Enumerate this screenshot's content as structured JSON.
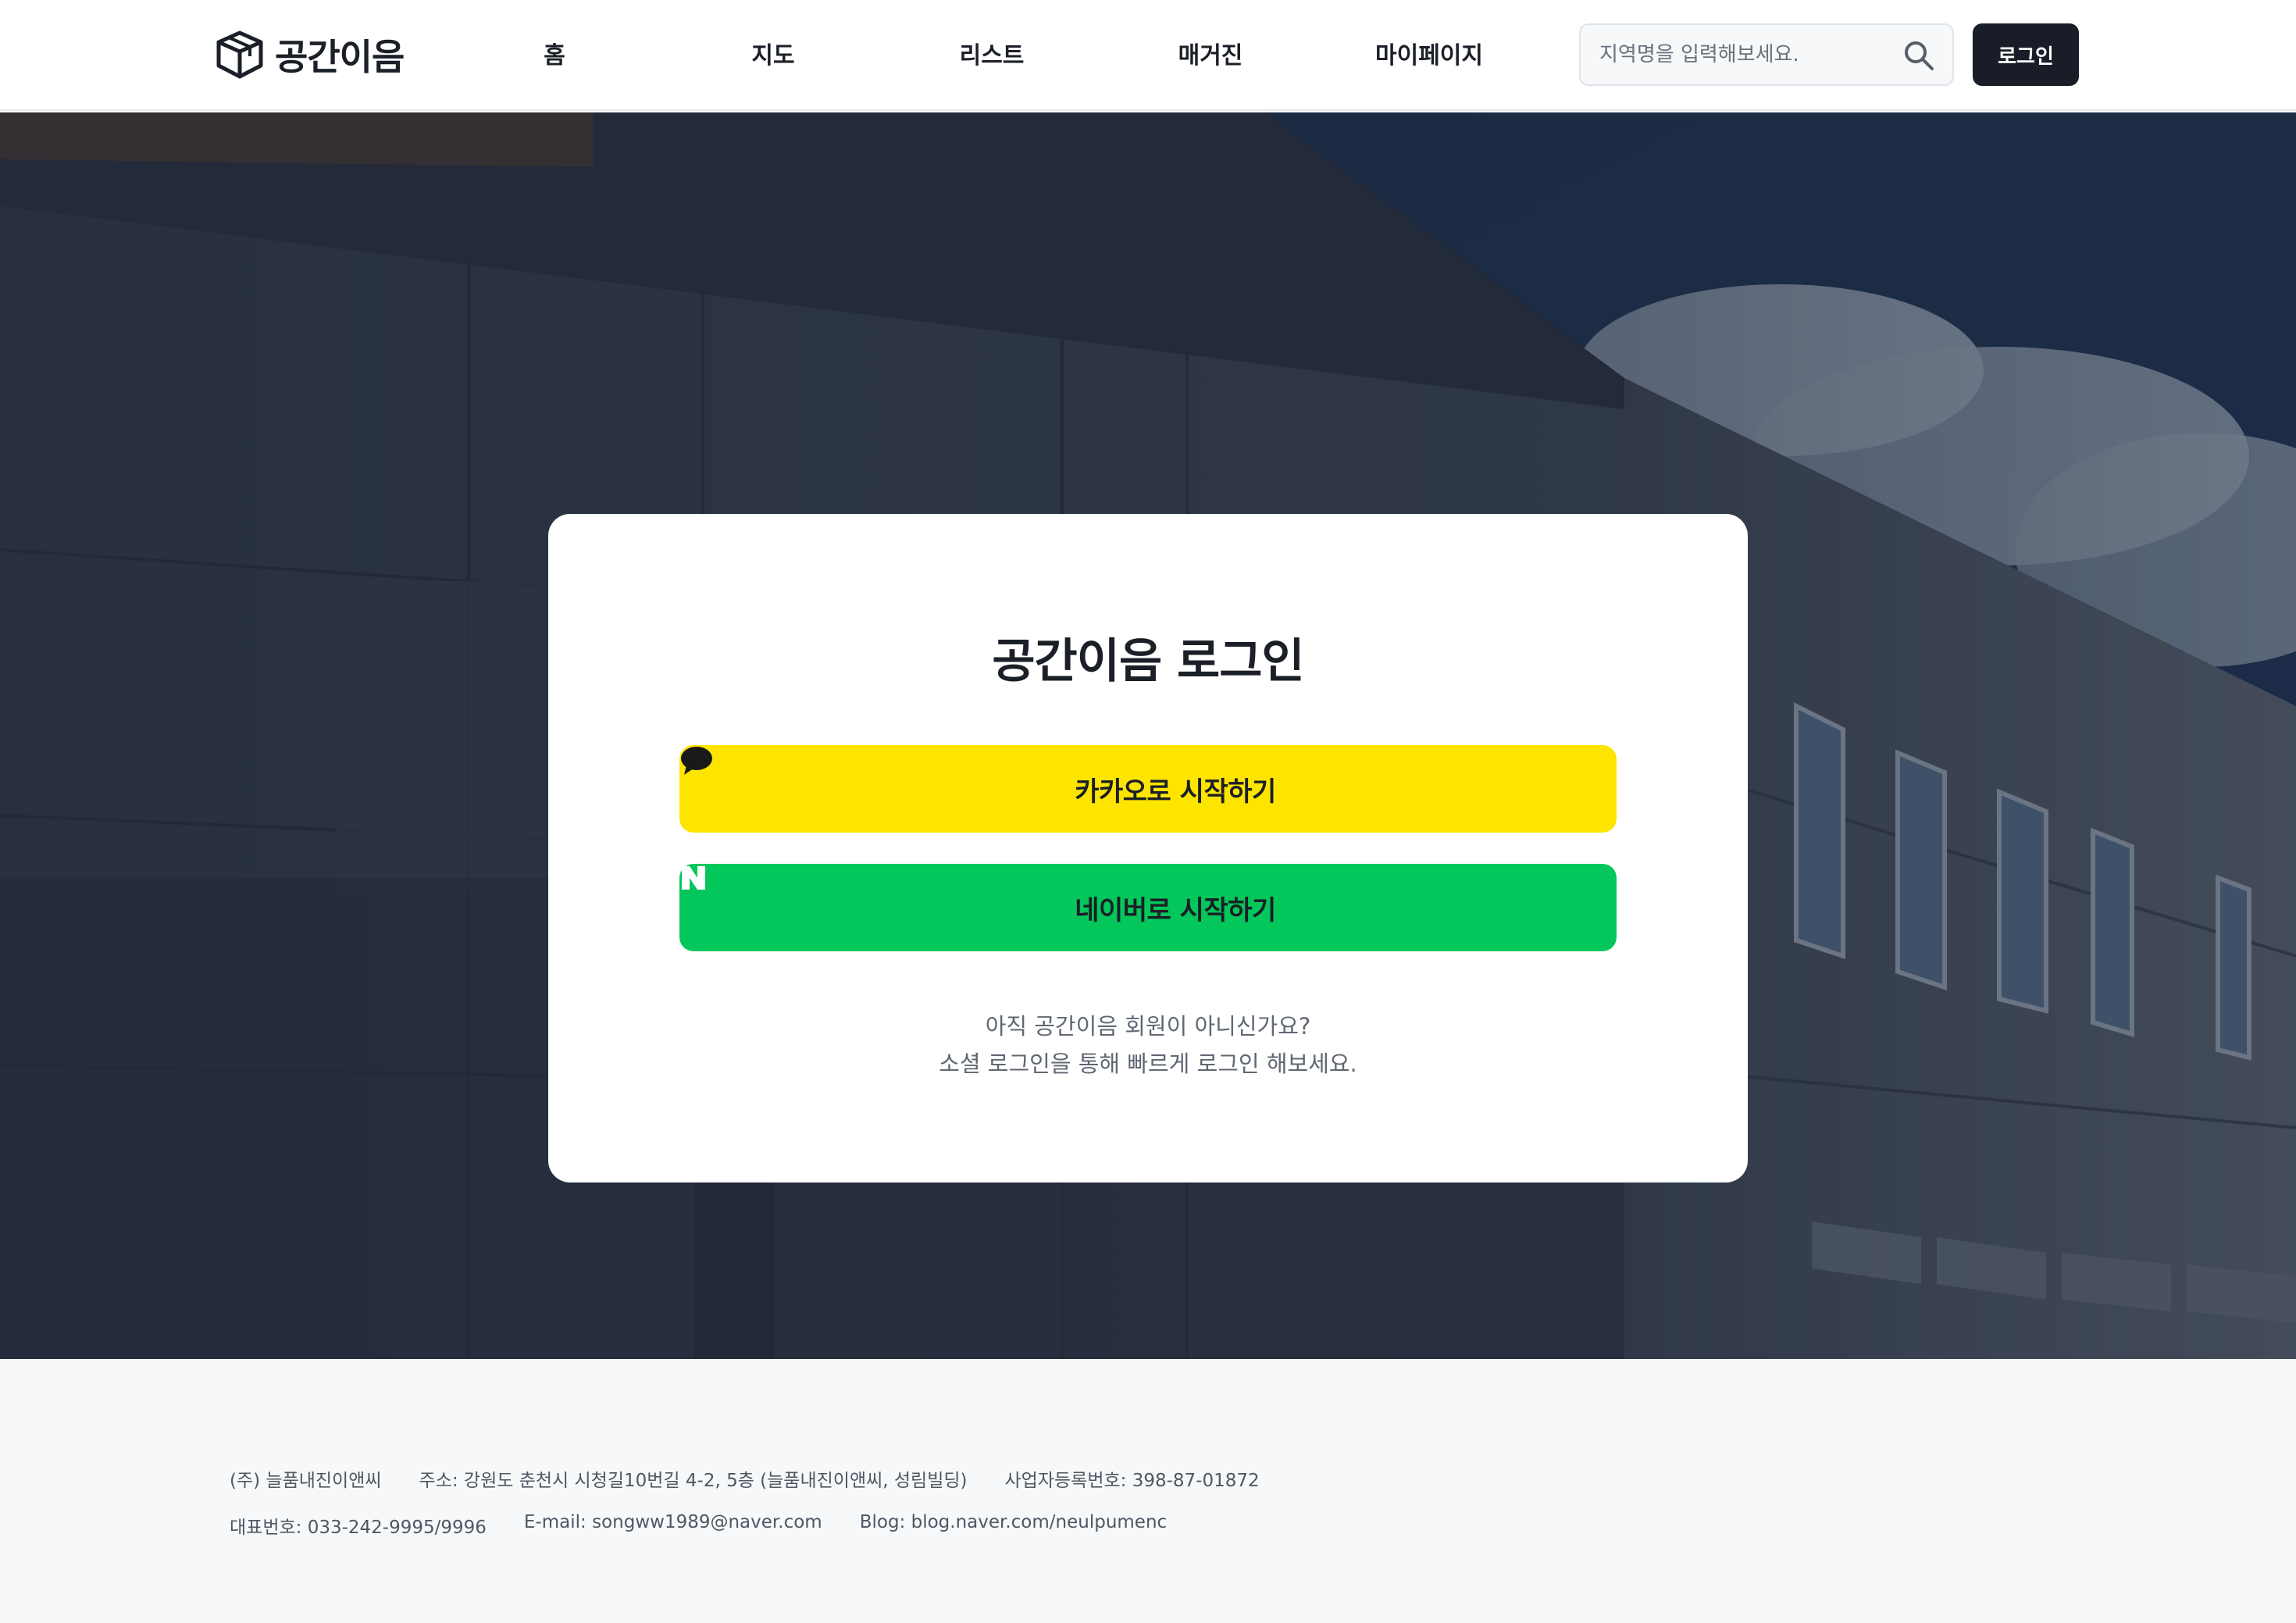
{
  "header": {
    "logo_text": "공간이음",
    "nav": [
      {
        "label": "홈"
      },
      {
        "label": "지도"
      },
      {
        "label": "리스트"
      },
      {
        "label": "매거진"
      },
      {
        "label": "마이페이지"
      }
    ],
    "search": {
      "placeholder": "지역명을 입력해보세요.",
      "icon": "search-icon"
    },
    "login_label": "로그인"
  },
  "login_card": {
    "title": "공간이음 로그인",
    "kakao_label": "카카오로 시작하기",
    "kakao_icon": "speech-bubble-icon",
    "naver_label": "네이버로 시작하기",
    "naver_icon_letter": "N",
    "note_line1": "아직 공간이음 회원이 아니신가요?",
    "note_line2": "소셜 로그인을 통해 빠르게 로그인 해보세요."
  },
  "footer": {
    "company": "(주) 늘품내진이앤씨",
    "address": "주소: 강원도 춘천시 시청길10번길 4-2, 5층 (늘품내진이앤씨, 성림빌딩)",
    "business_no": "사업자등록번호: 398-87-01872",
    "phone": "대표번호: 033-242-9995/9996",
    "email": "E-mail: songww1989@naver.com",
    "blog": "Blog: blog.naver.com/neulpumenc"
  },
  "colors": {
    "kakao": "#fee500",
    "naver": "#03c75a",
    "dark_button": "#181d27",
    "footer_bg": "#f6f8f9"
  }
}
